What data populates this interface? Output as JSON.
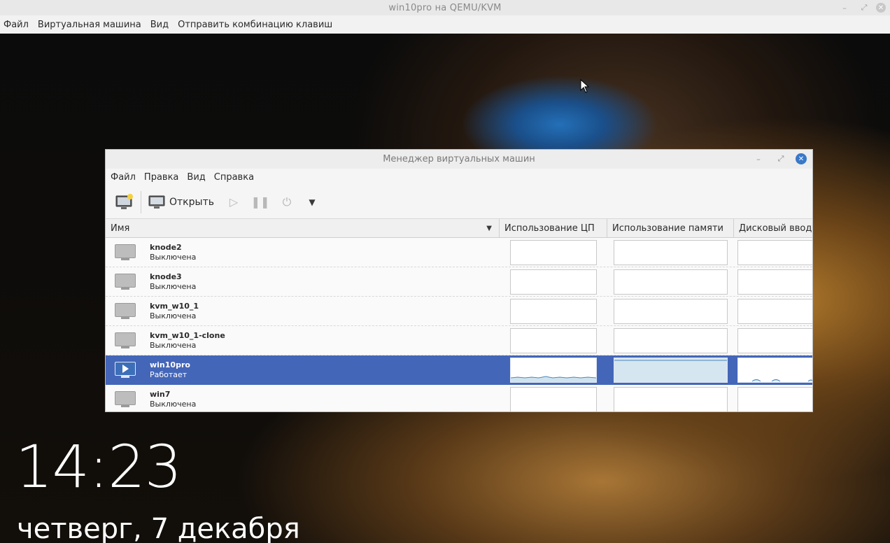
{
  "outer_window": {
    "title": "win10pro на QEMU/KVM",
    "menu": [
      "Файл",
      "Виртуальная машина",
      "Вид",
      "Отправить комбинацию клавиш"
    ]
  },
  "lock_screen": {
    "time": "14:23",
    "date": "четверг, 7 декабря"
  },
  "vm_manager": {
    "title": "Менеджер виртуальных машин",
    "menu": [
      "Файл",
      "Правка",
      "Вид",
      "Справка"
    ],
    "toolbar": {
      "open_label": "Открыть"
    },
    "columns": {
      "name": "Имя",
      "cpu": "Использование ЦП",
      "memory": "Использование памяти",
      "disk": "Дисковый ввод-в"
    },
    "vms": [
      {
        "name": "knode2",
        "status": "Выключена"
      },
      {
        "name": "knode3",
        "status": "Выключена"
      },
      {
        "name": "kvm_w10_1",
        "status": "Выключена"
      },
      {
        "name": "kvm_w10_1-clone",
        "status": "Выключена"
      },
      {
        "name": "win10pro",
        "status": "Работает"
      },
      {
        "name": "win7",
        "status": "Выключена"
      }
    ]
  },
  "colors": {
    "selection": "#4466b8",
    "close_button": "#3a78c8"
  }
}
